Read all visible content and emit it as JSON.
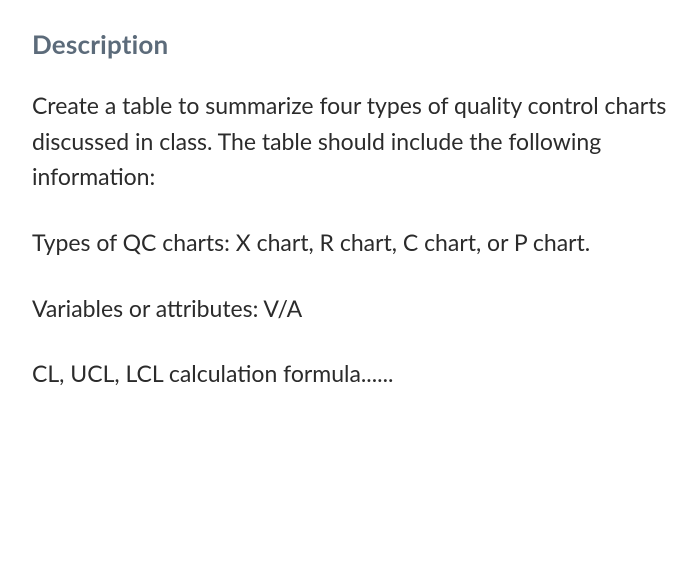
{
  "heading": "Description",
  "paragraphs": [
    "Create a table to summarize four types of quality control charts discussed in class. The table should include the following information:",
    "Types of QC charts: X chart, R chart, C chart, or P chart.",
    "Variables or attributes: V/A",
    "CL, UCL, LCL calculation formula......"
  ]
}
